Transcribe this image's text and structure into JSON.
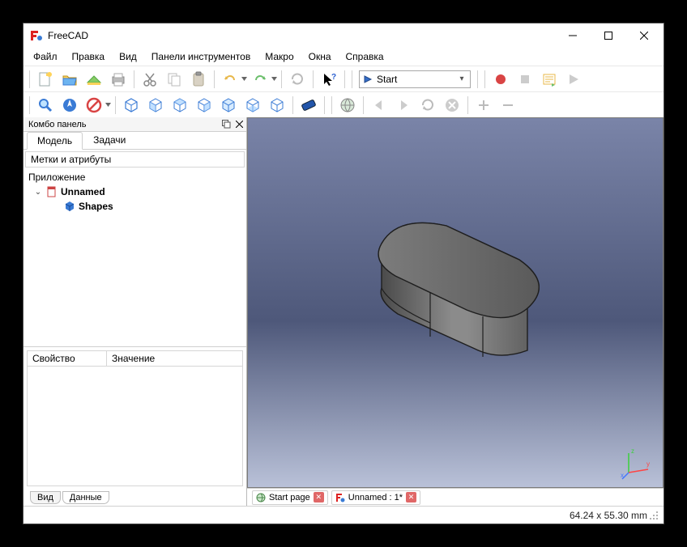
{
  "window": {
    "title": "FreeCAD"
  },
  "menu": {
    "file": "Файл",
    "edit": "Правка",
    "view": "Вид",
    "panels": "Панели инструментов",
    "macro": "Макро",
    "windows": "Окна",
    "help": "Справка"
  },
  "workbench": {
    "label": "Start"
  },
  "combo_panel": {
    "title": "Комбо панель",
    "tab_model": "Модель",
    "tab_tasks": "Задачи",
    "tree_header": "Метки и атрибуты",
    "app_label": "Приложение",
    "doc_label": "Unnamed",
    "shape_label": "Shapes"
  },
  "properties": {
    "col_property": "Свойство",
    "col_value": "Значение",
    "tab_view": "Вид",
    "tab_data": "Данные"
  },
  "doc_tabs": {
    "start": "Start page",
    "unnamed": "Unnamed : 1*"
  },
  "status": {
    "coords": "64.24 x 55.30 mm"
  },
  "axis": {
    "x": "x",
    "y": "y",
    "z": "z"
  }
}
